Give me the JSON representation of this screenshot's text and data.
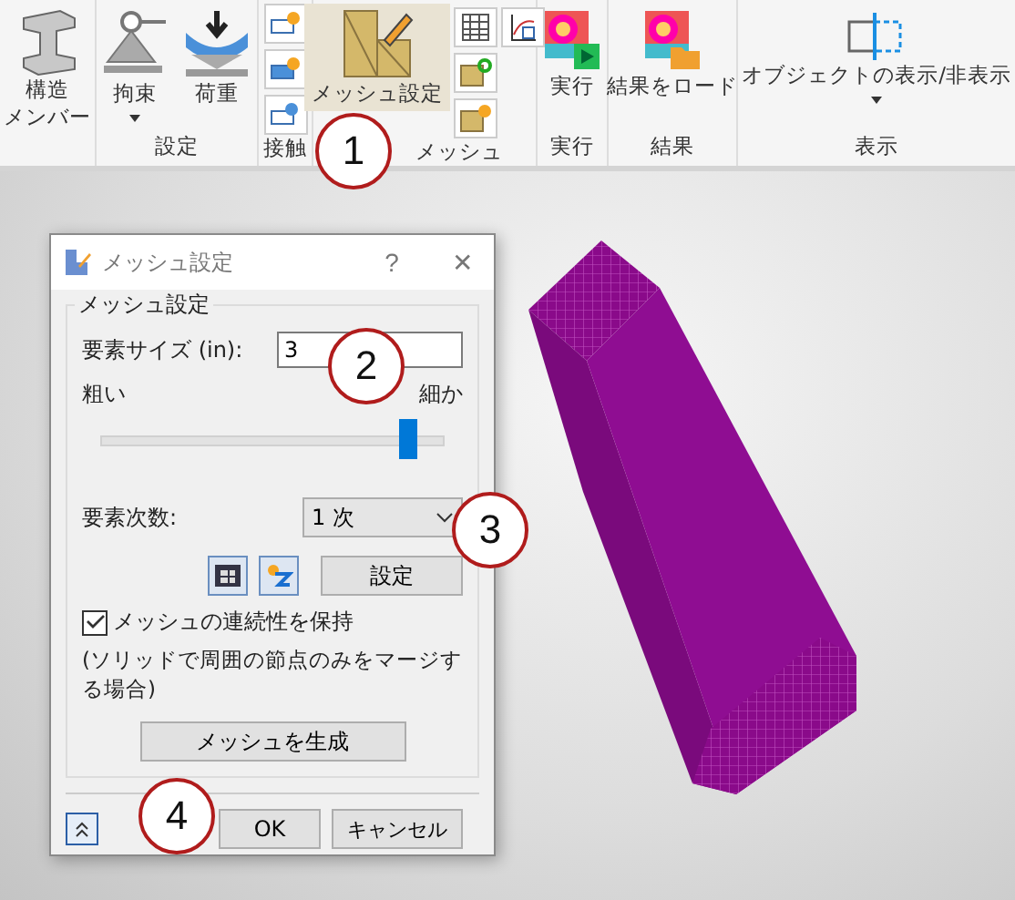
{
  "ribbon": {
    "groups": [
      {
        "buttons": [
          {
            "label_lines": [
              "構造",
              "メンバー"
            ]
          }
        ]
      },
      {
        "label": "設定",
        "buttons": [
          {
            "label": "拘束",
            "dropdown": true
          },
          {
            "label": "荷重",
            "dropdown": false
          }
        ]
      },
      {
        "label": "接触"
      },
      {
        "label": "メッシュ",
        "buttons": [
          {
            "label": "メッシュ設定",
            "highlighted": true
          }
        ]
      },
      {
        "label": "実行",
        "buttons": [
          {
            "label": "実行"
          }
        ]
      },
      {
        "label": "結果",
        "buttons": [
          {
            "label": "結果をロード"
          }
        ]
      },
      {
        "label": "表示",
        "buttons": [
          {
            "label": "オブジェクトの表示/非表示",
            "dropdown": true
          }
        ]
      }
    ]
  },
  "dialog": {
    "title": "メッシュ設定",
    "help": "?",
    "close": "✕",
    "group_title": "メッシュ設定",
    "size_label": "要素サイズ (in):",
    "size_value": "3",
    "coarse": "粗い",
    "fine": "細か",
    "slider": {
      "level": 0.9
    },
    "order_label": "要素次数:",
    "order_value": "1 次",
    "settings_button": "設定",
    "keep_continuity": {
      "label": "メッシュの連続性を保持",
      "checked": true
    },
    "note": "(ソリッドで周囲の節点のみをマージする場合)",
    "generate_button": "メッシュを生成",
    "ok": "OK",
    "cancel": "キャンセル"
  },
  "callouts": [
    "1",
    "2",
    "3",
    "4"
  ]
}
